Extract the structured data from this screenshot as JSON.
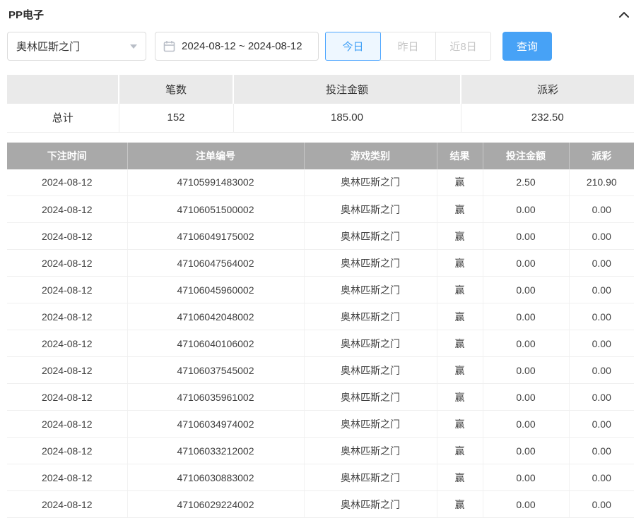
{
  "page": {
    "title": "PP电子"
  },
  "filters": {
    "game_select": {
      "value": "奥林匹斯之门"
    },
    "date_range": {
      "value": "2024-08-12 ~ 2024-08-12"
    },
    "quick_buttons": [
      {
        "label": "今日",
        "active": true
      },
      {
        "label": "昨日",
        "active": false
      },
      {
        "label": "近8日",
        "active": false
      }
    ],
    "search_label": "查询"
  },
  "summary": {
    "headers": [
      "",
      "笔数",
      "投注金额",
      "派彩"
    ],
    "row": {
      "label": "总计",
      "count": "152",
      "bet_amount": "185.00",
      "payout": "232.50"
    }
  },
  "table": {
    "headers": [
      "下注时间",
      "注单编号",
      "游戏类别",
      "结果",
      "投注金额",
      "派彩"
    ],
    "rows": [
      [
        "2024-08-12",
        "47105991483002",
        "奥林匹斯之门",
        "赢",
        "2.50",
        "210.90"
      ],
      [
        "2024-08-12",
        "47106051500002",
        "奥林匹斯之门",
        "赢",
        "0.00",
        "0.00"
      ],
      [
        "2024-08-12",
        "47106049175002",
        "奥林匹斯之门",
        "赢",
        "0.00",
        "0.00"
      ],
      [
        "2024-08-12",
        "47106047564002",
        "奥林匹斯之门",
        "赢",
        "0.00",
        "0.00"
      ],
      [
        "2024-08-12",
        "47106045960002",
        "奥林匹斯之门",
        "赢",
        "0.00",
        "0.00"
      ],
      [
        "2024-08-12",
        "47106042048002",
        "奥林匹斯之门",
        "赢",
        "0.00",
        "0.00"
      ],
      [
        "2024-08-12",
        "47106040106002",
        "奥林匹斯之门",
        "赢",
        "0.00",
        "0.00"
      ],
      [
        "2024-08-12",
        "47106037545002",
        "奥林匹斯之门",
        "赢",
        "0.00",
        "0.00"
      ],
      [
        "2024-08-12",
        "47106035961002",
        "奥林匹斯之门",
        "赢",
        "0.00",
        "0.00"
      ],
      [
        "2024-08-12",
        "47106034974002",
        "奥林匹斯之门",
        "赢",
        "0.00",
        "0.00"
      ],
      [
        "2024-08-12",
        "47106033212002",
        "奥林匹斯之门",
        "赢",
        "0.00",
        "0.00"
      ],
      [
        "2024-08-12",
        "47106030883002",
        "奥林匹斯之门",
        "赢",
        "0.00",
        "0.00"
      ],
      [
        "2024-08-12",
        "47106029224002",
        "奥林匹斯之门",
        "赢",
        "0.00",
        "0.00"
      ]
    ]
  },
  "colors": {
    "accent_blue": "#47a2f6",
    "active_tab_blue": "#41a0f6",
    "table_header_gray": "#a9a9a9",
    "summary_header_gray": "#eaeaea"
  }
}
